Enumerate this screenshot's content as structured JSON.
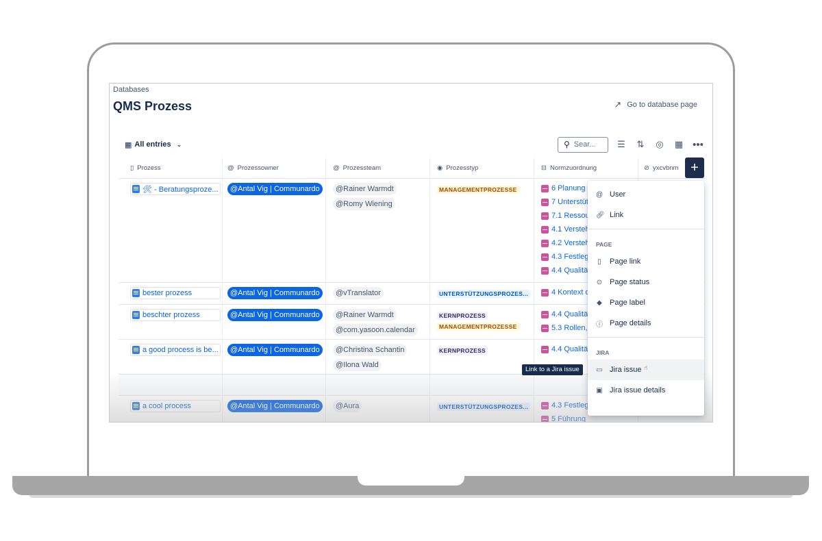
{
  "breadcrumb": "Databases",
  "title": "QMS Prozess",
  "goto_label": "Go to database page",
  "view_label": "All entries",
  "search_placeholder": "Sear...",
  "columns": {
    "prozess": "Prozess",
    "owner": "Prozessowner",
    "team": "Prozessteam",
    "typ": "Prozesstyp",
    "norm": "Normzuordnung",
    "extra": "yxcvbnm"
  },
  "rows": [
    {
      "page": "🛠 - Beratungsproze...",
      "owner": "@Antal Vig | Communardo",
      "team": [
        "@Rainer Warmdt",
        "@Romy Wiening"
      ],
      "typ": [
        "MANAGEMENTPROZESSE"
      ],
      "norm": [
        "6 Planung",
        "7 Unterstüt",
        "7.1 Ressour",
        "4.1 Verstehe",
        "4.2 Verstehe",
        "4.3 Festleg",
        "4.4 Qualitä"
      ]
    },
    {
      "page": "bester prozess",
      "owner": "@Antal Vig | Communardo",
      "team": [
        "@vTranslator"
      ],
      "typ": [
        "UNTERSTÜTZUNGSPROZES..."
      ],
      "norm": [
        "4 Kontext d"
      ]
    },
    {
      "page": "beschter prozess",
      "owner": "@Antal Vig | Communardo",
      "team": [
        "@Rainer Warmdt",
        "@com.yasoon.calendar"
      ],
      "typ": [
        "KERNPROZESS",
        "MANAGEMENTPROZESSE"
      ],
      "norm": [
        "4.4 Qualitä",
        "5.3 Rollen,"
      ]
    },
    {
      "page": "a good process is be...",
      "owner": "@Antal Vig | Communardo",
      "team": [
        "@Christina Schantin",
        "@Ilona Wald"
      ],
      "typ": [
        "KERNPROZESS"
      ],
      "norm": [
        "4.4 Qualitä"
      ]
    },
    {
      "page": "a cool process",
      "owner": "@Antal Vig | Communardo",
      "team": [
        "@Aura"
      ],
      "typ": [
        "UNTERSTÜTZUNGSPROZES..."
      ],
      "norm": [
        "4.3 Festleg",
        "5 Führung"
      ]
    }
  ],
  "menu": {
    "user": "User",
    "link": "Link",
    "page_heading": "PAGE",
    "page_link": "Page link",
    "page_status": "Page status",
    "page_label": "Page label",
    "page_details": "Page details",
    "jira_heading": "JIRA",
    "jira_issue": "Jira issue",
    "jira_issue_details": "Jira issue details"
  },
  "tooltip": "Link to a Jira issue",
  "colors": {
    "accent": "#0c66e4",
    "plus_button": "#1d2d4a",
    "norm_icon": "#cd519d"
  }
}
